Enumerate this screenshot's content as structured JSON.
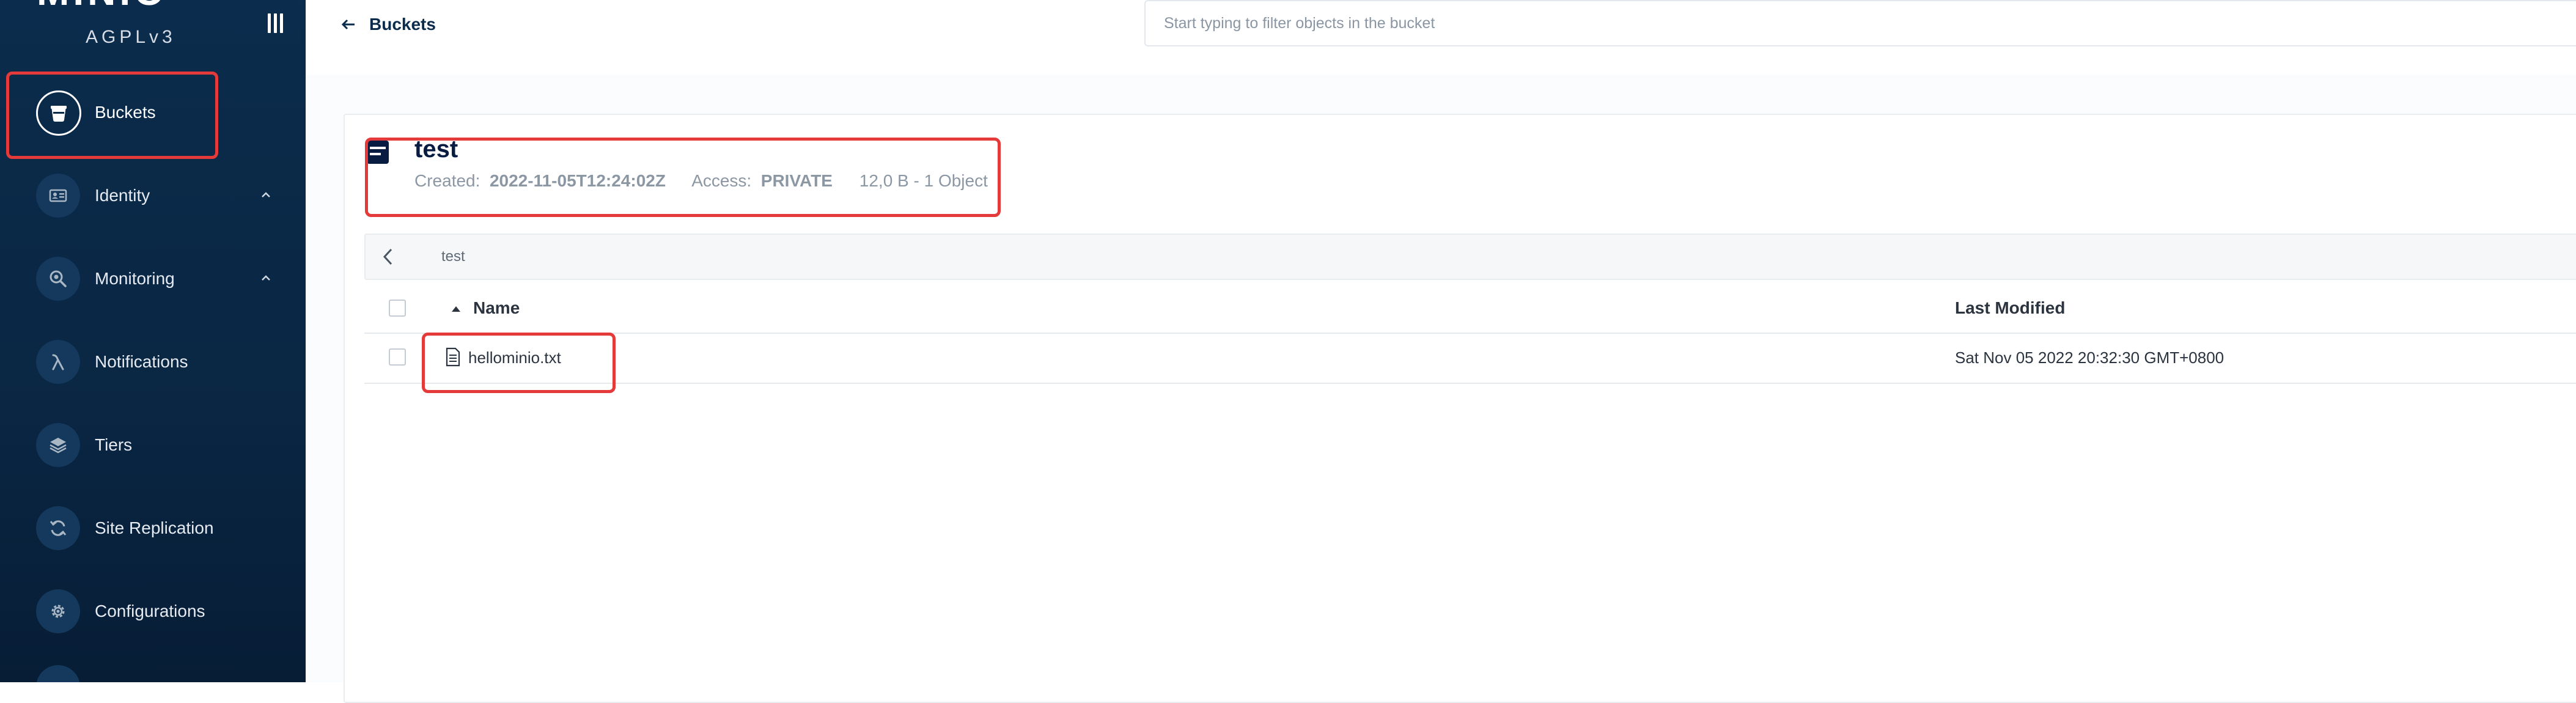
{
  "sidebar": {
    "logo": "MINIO",
    "license": "AGPLv3",
    "items": [
      {
        "label": "Buckets",
        "icon": "bucket-icon"
      },
      {
        "label": "Identity",
        "icon": "identity-card-icon"
      },
      {
        "label": "Monitoring",
        "icon": "search-zoom-icon"
      },
      {
        "label": "Notifications",
        "icon": "lambda-icon"
      },
      {
        "label": "Tiers",
        "icon": "layers-icon"
      },
      {
        "label": "Site Replication",
        "icon": "sync-icon"
      },
      {
        "label": "Configurations",
        "icon": "gear-icon"
      }
    ]
  },
  "topbar": {
    "back_label": "Buckets",
    "filter_placeholder": "Start typing to filter objects in the bucket"
  },
  "bucket": {
    "name": "test",
    "created_label": "Created:",
    "created_value": "2022-11-05T12:24:02Z",
    "access_label": "Access:",
    "access_value": "PRIVATE",
    "usage": "12,0 B - 1 Object"
  },
  "breadcrumb": {
    "path": "test"
  },
  "table": {
    "columns": {
      "name": "Name",
      "last_modified": "Last Modified"
    },
    "rows": [
      {
        "name": "hellominio.txt",
        "last_modified": "Sat Nov 05 2022 20:32:30 GMT+0800"
      }
    ]
  },
  "colors": {
    "sidebar_bg": "#0b2c4c",
    "highlight_red": "#e53a3a",
    "title_navy": "#081c42"
  }
}
